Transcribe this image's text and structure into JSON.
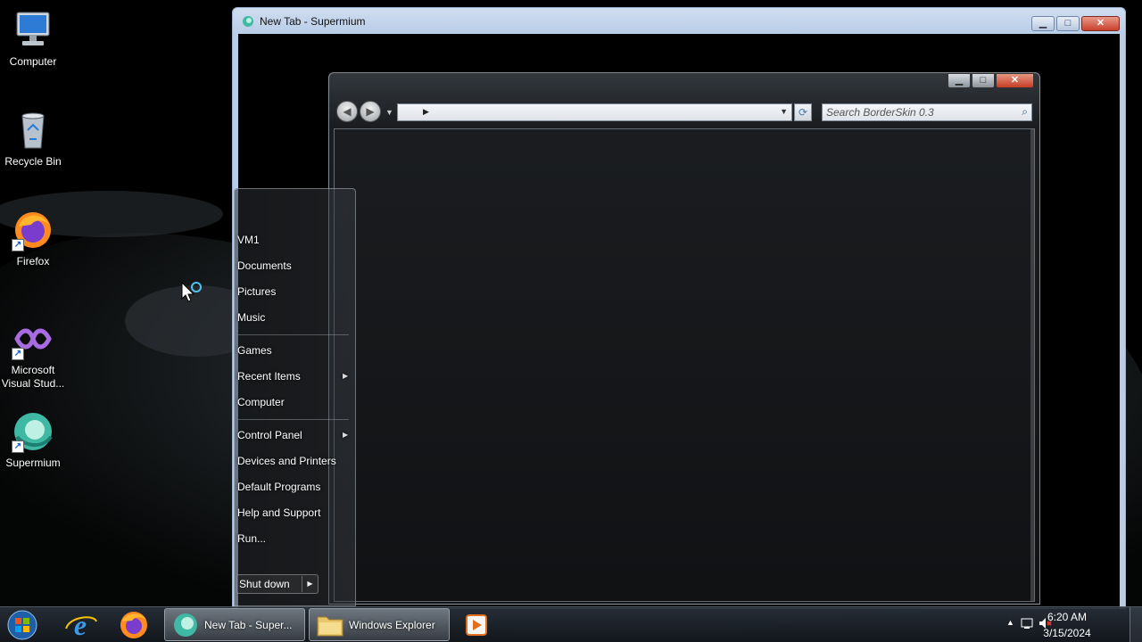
{
  "desktop": {
    "icons": [
      {
        "label": "Computer",
        "icon": "computer-icon"
      },
      {
        "label": "Recycle Bin",
        "icon": "recycle-bin-icon"
      },
      {
        "label": "Firefox",
        "icon": "firefox-icon"
      },
      {
        "label": "Microsoft Visual Stud...",
        "icon": "visual-studio-icon"
      },
      {
        "label": "Supermium",
        "icon": "supermium-icon"
      }
    ]
  },
  "browser_window": {
    "title": "New Tab - Supermium",
    "icon": "supermium-icon"
  },
  "explorer_window": {
    "search_placeholder": "Search BorderSkin 0.3"
  },
  "start_menu": {
    "items": [
      {
        "label": "VM1"
      },
      {
        "label": "Documents"
      },
      {
        "label": "Pictures"
      },
      {
        "label": "Music"
      },
      {
        "label": "Games"
      },
      {
        "label": "Recent Items",
        "has_submenu": true
      },
      {
        "label": "Computer"
      },
      {
        "label": "Control Panel",
        "has_submenu": true
      },
      {
        "label": "Devices and Printers"
      },
      {
        "label": "Default Programs"
      },
      {
        "label": "Help and Support"
      },
      {
        "label": "Run..."
      }
    ],
    "shutdown_label": "Shut down"
  },
  "taskbar": {
    "buttons": [
      {
        "label": "New Tab - Super...",
        "icon": "supermium-icon"
      },
      {
        "label": "Windows Explorer",
        "icon": "folder-icon"
      }
    ],
    "pinned": [
      "internet-explorer-icon",
      "firefox-icon",
      "media-player-icon"
    ],
    "clock": {
      "time": "6:20 AM",
      "date": "3/15/2024"
    }
  },
  "colors": {
    "taskbar": "#1c232b",
    "window_frame": "#b9cde8",
    "close_button": "#c8402c"
  }
}
